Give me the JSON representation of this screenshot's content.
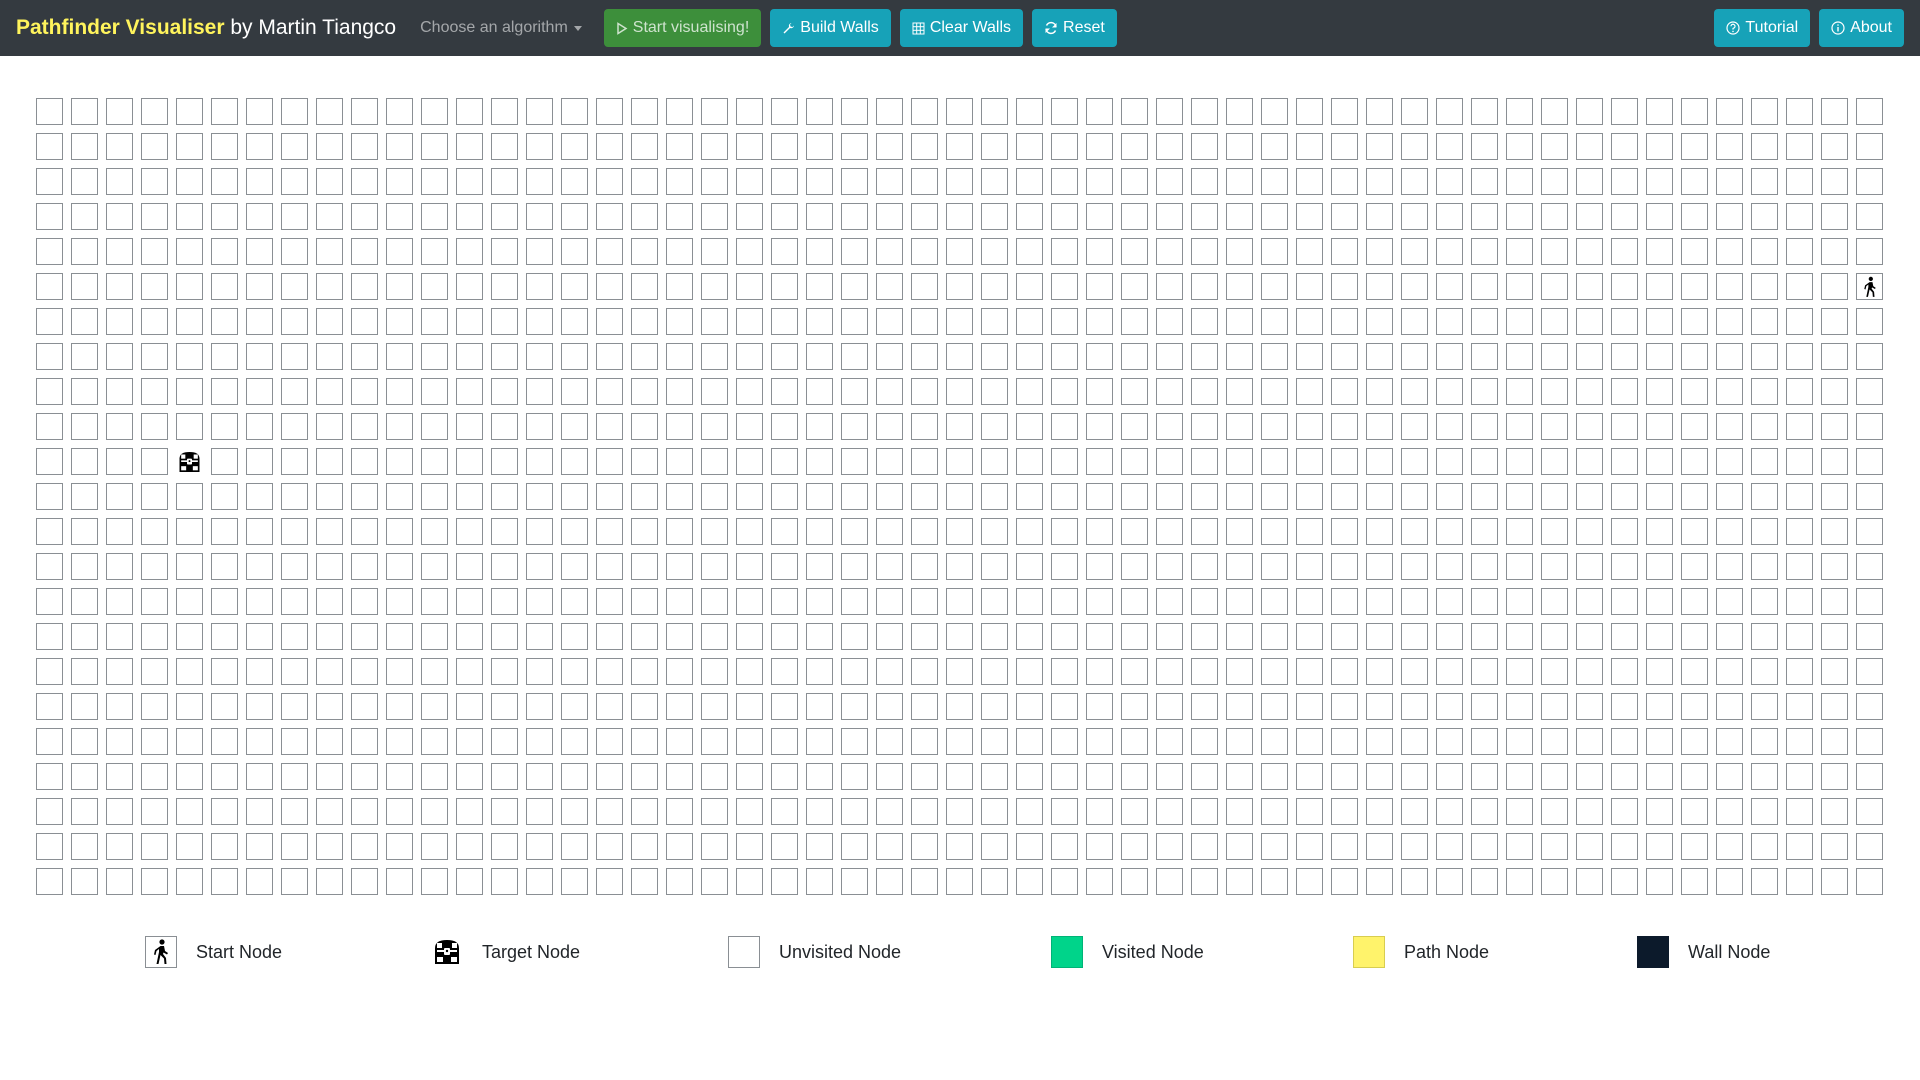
{
  "navbar": {
    "brand_highlight": "Pathfinder Visualiser",
    "brand_author": " by Martin Tiangco",
    "algorithm_dropdown": "Choose an algorithm",
    "start_label": "Start visualising!",
    "build_walls_label": "Build Walls",
    "clear_walls_label": "Clear Walls",
    "reset_label": "Reset",
    "tutorial_label": "Tutorial",
    "about_label": "About"
  },
  "grid": {
    "rows": 23,
    "cols": 53,
    "start_node": {
      "row": 5,
      "col": 52
    },
    "target_node": {
      "row": 10,
      "col": 4
    }
  },
  "legend": {
    "items": [
      {
        "label": "Start Node",
        "icon": "walking-person-icon"
      },
      {
        "label": "Target Node",
        "icon": "treasure-chest-icon"
      },
      {
        "label": "Unvisited Node",
        "color": "#ffffff"
      },
      {
        "label": "Visited Node",
        "color": "#00d48a"
      },
      {
        "label": "Path Node",
        "color": "#fff36b"
      },
      {
        "label": "Wall Node",
        "color": "#0c1a2b"
      }
    ]
  },
  "colors": {
    "navbar": "#343a40",
    "brand_highlight": "#fff45c",
    "start_button": "#3d8f3b",
    "info_button": "#17a2b8"
  }
}
